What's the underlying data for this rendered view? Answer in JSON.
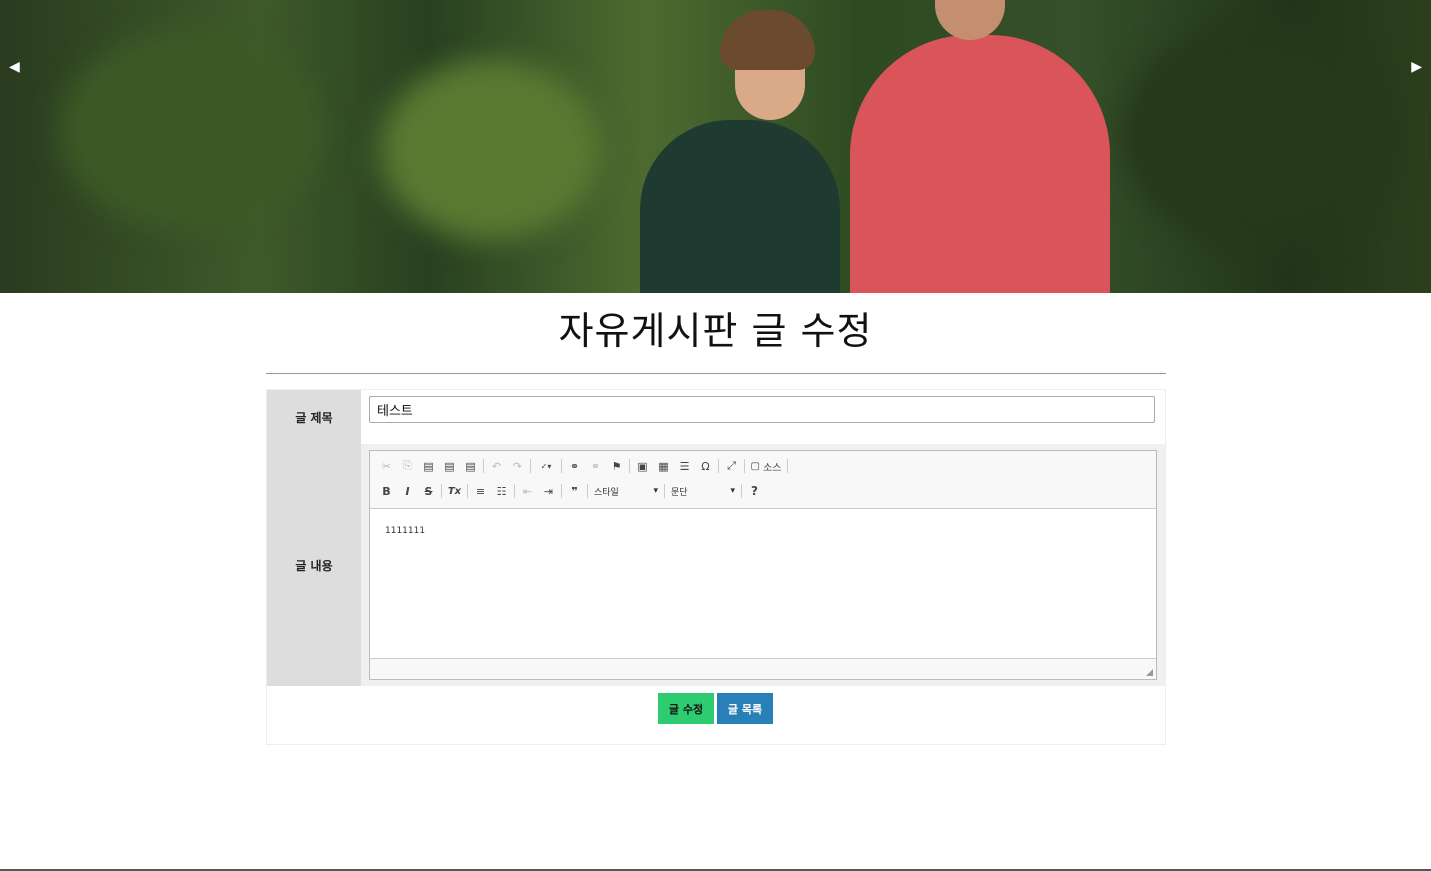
{
  "hero": {
    "prev_arrow": "◀",
    "next_arrow": "▶"
  },
  "page": {
    "title": "자유게시판 글 수정"
  },
  "form": {
    "title_label": "글 제목",
    "title_value": "테스트",
    "content_label": "글 내용",
    "content_value": "1111111"
  },
  "editor": {
    "toolbar_row1": [
      "✂",
      "⎘",
      "📋",
      "📋",
      "📋",
      "↶",
      "↷",
      "ABC▾",
      "🔗",
      "⛓",
      "⚑",
      "🖼",
      "▦",
      "☰",
      "Ω",
      "⤢"
    ],
    "source_label": "소스",
    "style_combo": "스타일",
    "format_combo": "문단",
    "bold": "B",
    "italic": "I",
    "strike": "S",
    "clear_format": "Tx",
    "help": "?"
  },
  "buttons": {
    "edit": "글 수정",
    "list": "글 목록"
  },
  "colors": {
    "edit_button": "#2ecc71",
    "list_button": "#2980b9",
    "label_bg": "#dddddd"
  }
}
